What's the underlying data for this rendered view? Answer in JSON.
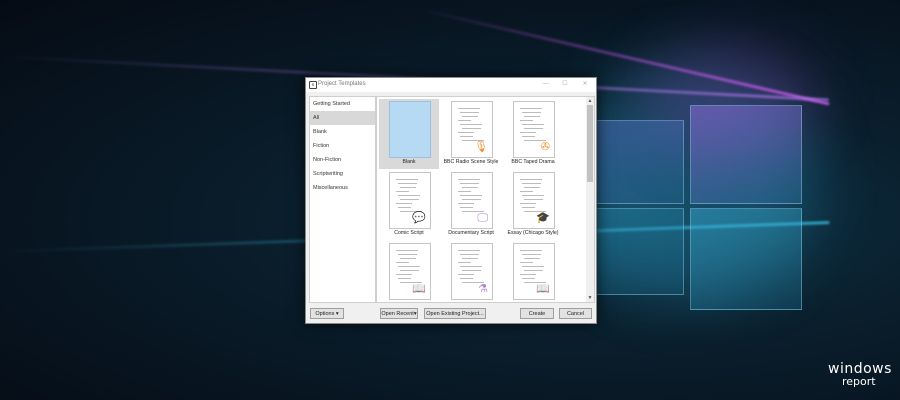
{
  "window": {
    "title": "Project Templates",
    "controls": {
      "minimize": "—",
      "maximize": "☐",
      "close": "✕"
    }
  },
  "sidebar": {
    "categories": [
      {
        "label": "Getting Started",
        "selected": false
      },
      {
        "label": "All",
        "selected": true
      },
      {
        "label": "Blank",
        "selected": false
      },
      {
        "label": "Fiction",
        "selected": false
      },
      {
        "label": "Non-Fiction",
        "selected": false
      },
      {
        "label": "Scriptwriting",
        "selected": false
      },
      {
        "label": "Miscellaneous",
        "selected": false
      }
    ]
  },
  "templates": [
    {
      "label": "Blank",
      "selected": true,
      "icon": null
    },
    {
      "label": "BBC Radio Scene Style",
      "icon": "microphone-icon",
      "icon_color": "#f28c28"
    },
    {
      "label": "BBC Taped Drama",
      "icon": "film-reel-icon",
      "icon_color": "#f28c28"
    },
    {
      "label": "Comic Script",
      "icon": "speech-bubble-icon",
      "icon_color": "#f3c431"
    },
    {
      "label": "Documentary Script",
      "icon": "monitor-icon",
      "icon_color": "#b383d8"
    },
    {
      "label": "Essay (Chicago Style)",
      "icon": "graduation-cap-icon",
      "icon_color": "#6e6ad4"
    },
    {
      "label": "",
      "icon": "book-icon",
      "icon_color": "#5aa5e8"
    },
    {
      "label": "",
      "icon": "flask-icon",
      "icon_color": "#b383d8"
    },
    {
      "label": "",
      "icon": "book-icon",
      "icon_color": "#5aa5e8"
    }
  ],
  "footer": {
    "options_label": "Options",
    "open_recent_label": "Open Recent",
    "open_existing_label": "Open Existing Project...",
    "create_label": "Create",
    "cancel_label": "Cancel"
  },
  "brand": {
    "line1": "windows",
    "line2": "report"
  },
  "colors": {
    "blank_thumb": "#b6d9f4",
    "selection": "#d9d9d9",
    "accent_orange": "#f28c28"
  }
}
